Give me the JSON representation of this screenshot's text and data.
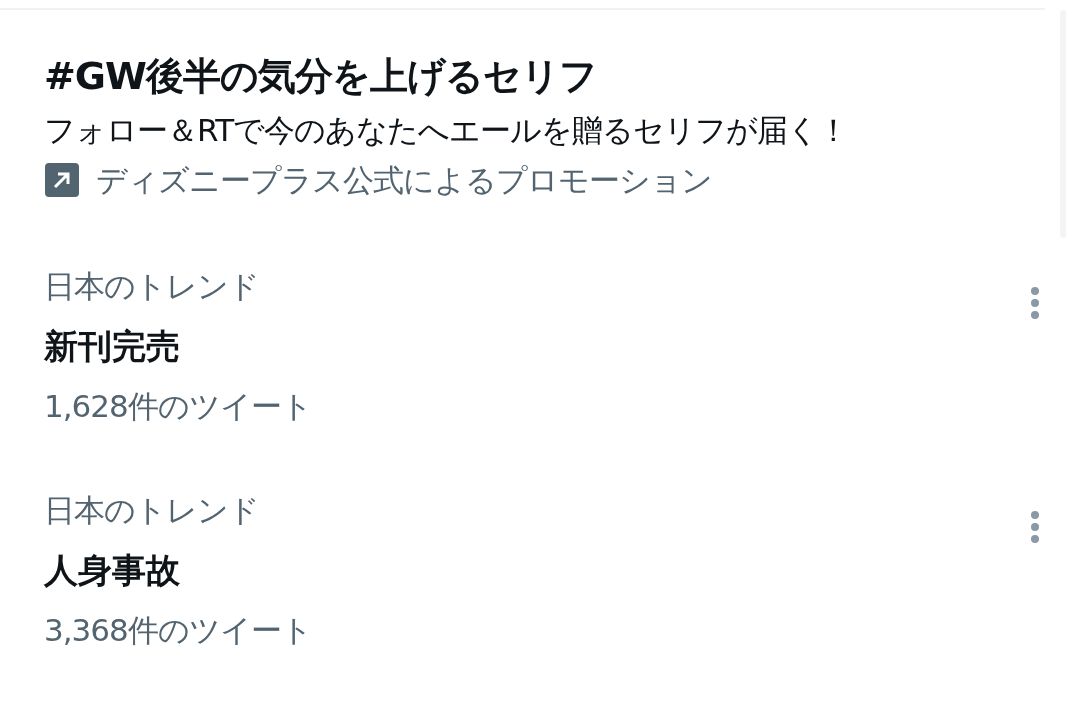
{
  "promoted": {
    "title": "#GW後半の気分を上げるセリフ",
    "description": "フォロー＆RTで今のあなたへエールを贈るセリフが届く！",
    "promoter": "ディズニープラス公式によるプロモーション"
  },
  "trends": [
    {
      "context": "日本のトレンド",
      "title": "新刊完売",
      "count": "1,628件のツイート"
    },
    {
      "context": "日本のトレンド",
      "title": "人身事故",
      "count": "3,368件のツイート"
    }
  ]
}
